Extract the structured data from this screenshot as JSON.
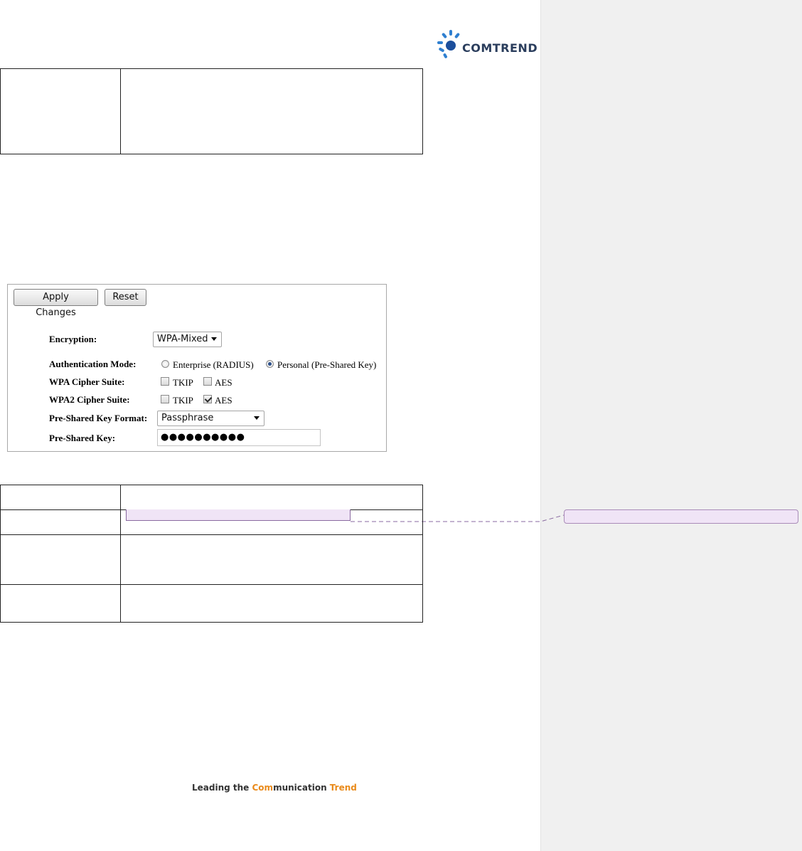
{
  "header": {
    "logo_text": "COMTREND",
    "logo_icon": "sunburst-logo-icon"
  },
  "panel": {
    "apply_label": "Apply Changes",
    "reset_label": "Reset",
    "encryption_label": "Encryption:",
    "encryption_value": "WPA-Mixed",
    "auth_label": "Authentication Mode:",
    "auth_options": [
      "Enterprise (RADIUS)",
      "Personal (Pre-Shared Key)"
    ],
    "auth_selected": "Personal (Pre-Shared Key)",
    "wpa_label": "WPA Cipher Suite:",
    "wpa2_label": "WPA2 Cipher Suite:",
    "cipher_tkip": "TKIP",
    "cipher_aes": "AES",
    "wpa_checked": [],
    "wpa2_checked": [
      "AES"
    ],
    "psk_format_label": "Pre-Shared Key Format:",
    "psk_format_value": "Passphrase",
    "psk_label": "Pre-Shared Key:",
    "psk_value": "●●●●●●●●●●"
  },
  "footer": {
    "text_a": "Leading the ",
    "text_accent_a": "Com",
    "text_b": "munication ",
    "text_accent_b": "Trend"
  },
  "colors": {
    "comment_highlight": "#f0e4f6",
    "comment_border": "#a98bb8",
    "footer_accent": "#e98a1a"
  }
}
